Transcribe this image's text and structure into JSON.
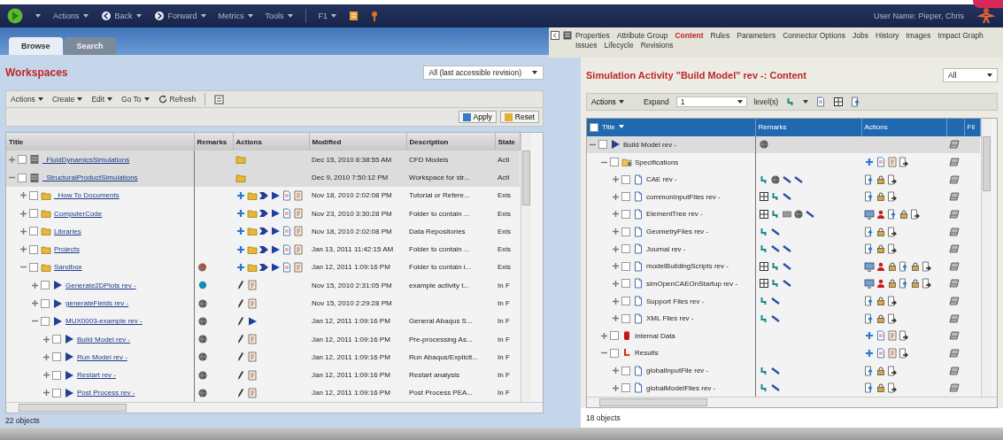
{
  "top_bar": {
    "menus": [
      {
        "label": "Actions"
      },
      {
        "label": "Back",
        "kind": "back"
      },
      {
        "label": "Forward",
        "kind": "forward"
      },
      {
        "label": "Metrics"
      },
      {
        "label": "Tools"
      },
      {
        "label": "F1"
      }
    ],
    "user": "User Name: Pieper, Chris"
  },
  "left": {
    "tabs": [
      {
        "label": "Browse",
        "selected": true
      },
      {
        "label": "Search",
        "selected": false
      }
    ],
    "heading": "Workspaces",
    "revision_filter": "All (last accessible revision)",
    "menus": [
      "Actions",
      "Create",
      "Edit",
      "Go To"
    ],
    "refresh": "Refresh",
    "apply": "Apply",
    "reset": "Reset",
    "table": {
      "columns": [
        "Title",
        "Remarks",
        "Actions",
        "Modified",
        "Description",
        "State"
      ],
      "rows": [
        {
          "title": "_FluidDynamicsSimulations",
          "kind": "workspace",
          "checked": false,
          "expanded": false,
          "selected": true,
          "actions": [
            {
              "kind": "folder"
            }
          ],
          "modified": "Dec 15, 2010 8:38:55 AM",
          "description": "CFD Models",
          "state": "Acti"
        },
        {
          "title": "_StructuralProductSimulations",
          "kind": "workspace",
          "checked": false,
          "expanded": true,
          "selected": true,
          "actions": [
            {
              "kind": "folder"
            }
          ],
          "modified": "Dec 9, 2010 7:50:12 PM",
          "description": "Workspace for str...",
          "state": "Acti",
          "children": [
            {
              "title": "_How To Documents",
              "kind": "folder",
              "checked": false,
              "expanded": false,
              "selected": false,
              "actions": [
                {
                  "kind": "add"
                },
                {
                  "kind": "folder"
                },
                {
                  "kind": "arrow"
                },
                {
                  "kind": "play"
                },
                {
                  "kind": "page"
                },
                {
                  "kind": "form"
                }
              ],
              "modified": "Nov 18, 2010 2:02:08 PM",
              "description": "Tutorial or Refere...",
              "state": "Exis"
            },
            {
              "title": "ComputerCode",
              "kind": "folder",
              "checked": false,
              "expanded": false,
              "selected": false,
              "actions": [
                {
                  "kind": "add"
                },
                {
                  "kind": "folder"
                },
                {
                  "kind": "arrow"
                },
                {
                  "kind": "play"
                },
                {
                  "kind": "page"
                },
                {
                  "kind": "form"
                }
              ],
              "modified": "Nov 23, 2010 3:30:28 PM",
              "description": "Folder to contain ...",
              "state": "Exis"
            },
            {
              "title": "Libraries",
              "kind": "folder",
              "checked": false,
              "expanded": false,
              "selected": false,
              "actions": [
                {
                  "kind": "add"
                },
                {
                  "kind": "folder"
                },
                {
                  "kind": "arrow"
                },
                {
                  "kind": "play"
                },
                {
                  "kind": "page"
                },
                {
                  "kind": "form"
                }
              ],
              "modified": "Nov 18, 2010 2:02:08 PM",
              "description": "Data Repositories",
              "state": "Exis"
            },
            {
              "title": "Projects",
              "kind": "folder",
              "checked": false,
              "expanded": false,
              "selected": false,
              "actions": [
                {
                  "kind": "add"
                },
                {
                  "kind": "folder"
                },
                {
                  "kind": "arrow"
                },
                {
                  "kind": "play"
                },
                {
                  "kind": "page"
                },
                {
                  "kind": "form"
                }
              ],
              "modified": "Jan 13, 2011 11:42:15 AM",
              "description": "Folder to contain ...",
              "state": "Exis"
            },
            {
              "title": "Sandbox",
              "kind": "folder",
              "checked": false,
              "expanded": true,
              "selected": false,
              "remarks": [
                {
                  "kind": "chart"
                }
              ],
              "actions": [
                {
                  "kind": "add"
                },
                {
                  "kind": "folder"
                },
                {
                  "kind": "arrow"
                },
                {
                  "kind": "play"
                },
                {
                  "kind": "page"
                },
                {
                  "kind": "form"
                }
              ],
              "modified": "Jan 12, 2011 1:09:16 PM",
              "description": "Folder to contain i...",
              "state": "Exis",
              "children": [
                {
                  "title": "Generate2DPlots rev -",
                  "kind": "activity",
                  "checked": false,
                  "expanded": false,
                  "selected": false,
                  "remarks": [
                    {
                      "kind": "dot"
                    }
                  ],
                  "actions": [
                    {
                      "kind": "pencil"
                    },
                    {
                      "kind": "form"
                    }
                  ],
                  "modified": "Nov 15, 2010 2:31:05 PM",
                  "description": "example activity t...",
                  "state": "In F"
                },
                {
                  "title": "generateFields rev -",
                  "kind": "activity",
                  "checked": false,
                  "expanded": false,
                  "selected": false,
                  "remarks": [
                    {
                      "kind": "globe"
                    }
                  ],
                  "actions": [
                    {
                      "kind": "pencil"
                    },
                    {
                      "kind": "form"
                    }
                  ],
                  "modified": "Nov 15, 2010 2:29:28 PM",
                  "state": "In F"
                },
                {
                  "title": "MUX0003-example rev -",
                  "kind": "activity",
                  "checked": false,
                  "expanded": true,
                  "selected": false,
                  "remarks": [
                    {
                      "kind": "globe"
                    }
                  ],
                  "actions": [
                    {
                      "kind": "pencil"
                    },
                    {
                      "kind": "play"
                    }
                  ],
                  "modified": "Jan 12, 2011 1:09:16 PM",
                  "description": "General Abaqus S...",
                  "state": "In F",
                  "children": [
                    {
                      "title": "Build Model rev -",
                      "kind": "activity",
                      "checked": false,
                      "expanded": false,
                      "selected": false,
                      "remarks": [
                        {
                          "kind": "globe"
                        }
                      ],
                      "actions": [
                        {
                          "kind": "pencil"
                        },
                        {
                          "kind": "form"
                        }
                      ],
                      "modified": "Jan 12, 2011 1:09:16 PM",
                      "description": "Pre-processing As...",
                      "state": "In F"
                    },
                    {
                      "title": "Run Model rev -",
                      "kind": "activity",
                      "checked": false,
                      "expanded": false,
                      "selected": false,
                      "remarks": [
                        {
                          "kind": "globe"
                        }
                      ],
                      "actions": [
                        {
                          "kind": "pencil"
                        },
                        {
                          "kind": "form"
                        }
                      ],
                      "modified": "Jan 12, 2011 1:09:16 PM",
                      "description": "Run Abaqus/Explicit...",
                      "state": "In F"
                    },
                    {
                      "title": "Restart rev -",
                      "kind": "activity",
                      "checked": false,
                      "expanded": false,
                      "selected": false,
                      "remarks": [
                        {
                          "kind": "globe"
                        }
                      ],
                      "actions": [
                        {
                          "kind": "pencil"
                        },
                        {
                          "kind": "form"
                        }
                      ],
                      "modified": "Jan 12, 2011 1:09:16 PM",
                      "description": "Restart analysis",
                      "state": "In F"
                    },
                    {
                      "title": "Post Process rev -",
                      "kind": "activity",
                      "checked": false,
                      "expanded": false,
                      "selected": false,
                      "remarks": [
                        {
                          "kind": "globe"
                        }
                      ],
                      "actions": [
                        {
                          "kind": "pencil"
                        },
                        {
                          "kind": "form"
                        }
                      ],
                      "modified": "Jan 12, 2011 1:09:16 PM",
                      "description": "Post Process PEA...",
                      "state": "In F"
                    }
                  ]
                }
              ]
            }
          ]
        }
      ]
    },
    "status": "22 objects"
  },
  "right": {
    "tabs": [
      {
        "label": "Properties",
        "selected": false
      },
      {
        "label": "Attribute Group",
        "selected": false
      },
      {
        "label": "Content",
        "selected": true
      },
      {
        "label": "Rules",
        "selected": false
      },
      {
        "label": "Parameters",
        "selected": false
      },
      {
        "label": "Connector Options",
        "selected": false
      },
      {
        "label": "Jobs",
        "selected": false
      },
      {
        "label": "History",
        "selected": false
      },
      {
        "label": "Images",
        "selected": false
      },
      {
        "label": "Impact Graph",
        "selected": false
      },
      {
        "label": "Issues",
        "selected": false
      },
      {
        "label": "Lifecycle",
        "selected": false
      },
      {
        "label": "Revisions",
        "selected": false
      }
    ],
    "heading": "Simulation Activity \"Build Model\" rev -: Content",
    "filter": "All",
    "menu": "Actions",
    "expand_label": "Expand",
    "expand_value": "1",
    "levels_label": "level(s)",
    "table": {
      "columns": [
        "Title",
        "Remarks",
        "Actions"
      ],
      "column_5": "Fil",
      "rows": [
        {
          "title": "Build Model rev -",
          "kind": "activity",
          "checked": false,
          "expanded": true,
          "selected": true,
          "remarks": [
            {
              "kind": "globe"
            }
          ],
          "children": [
            {
              "title": "Specifications",
              "kind": "specs",
              "checked": false,
              "expanded": true,
              "selected": false,
              "actions": [
                {
                  "kind": "add"
                },
                {
                  "kind": "page"
                },
                {
                  "kind": "form"
                },
                {
                  "kind": "export"
                }
              ],
              "children": [
                {
                  "title": "CAE rev -",
                  "kind": "document",
                  "checked": false,
                  "expanded": false,
                  "selected": false,
                  "remarks": [
                    {
                      "kind": "hook"
                    },
                    {
                      "kind": "globe"
                    },
                    {
                      "kind": "link"
                    },
                    {
                      "kind": "link"
                    }
                  ],
                  "actions": [
                    {
                      "kind": "upload"
                    },
                    {
                      "kind": "lock"
                    },
                    {
                      "kind": "export"
                    }
                  ]
                },
                {
                  "title": "commonInputFiles rev -",
                  "kind": "document",
                  "checked": false,
                  "expanded": false,
                  "selected": false,
                  "remarks": [
                    {
                      "kind": "grid"
                    },
                    {
                      "kind": "hook"
                    },
                    {
                      "kind": "link"
                    }
                  ],
                  "actions": [
                    {
                      "kind": "upload"
                    },
                    {
                      "kind": "lock"
                    },
                    {
                      "kind": "export"
                    }
                  ]
                },
                {
                  "title": "ElementTree rev -",
                  "kind": "document",
                  "checked": false,
                  "expanded": false,
                  "selected": false,
                  "remarks": [
                    {
                      "kind": "grid"
                    },
                    {
                      "kind": "hook"
                    },
                    {
                      "kind": "bar"
                    },
                    {
                      "kind": "globe"
                    },
                    {
                      "kind": "link"
                    }
                  ],
                  "actions": [
                    {
                      "kind": "monitor"
                    },
                    {
                      "kind": "person"
                    },
                    {
                      "kind": "upload"
                    },
                    {
                      "kind": "lock"
                    },
                    {
                      "kind": "export"
                    }
                  ]
                },
                {
                  "title": "GeometryFiles rev -",
                  "kind": "document",
                  "checked": false,
                  "expanded": false,
                  "selected": false,
                  "remarks": [
                    {
                      "kind": "hook"
                    },
                    {
                      "kind": "link"
                    }
                  ],
                  "actions": [
                    {
                      "kind": "upload"
                    },
                    {
                      "kind": "lock"
                    },
                    {
                      "kind": "export"
                    }
                  ]
                },
                {
                  "title": "Journal rev -",
                  "kind": "document",
                  "checked": false,
                  "expanded": false,
                  "selected": false,
                  "remarks": [
                    {
                      "kind": "hook"
                    },
                    {
                      "kind": "link"
                    },
                    {
                      "kind": "link"
                    }
                  ],
                  "actions": [
                    {
                      "kind": "upload"
                    },
                    {
                      "kind": "lock"
                    },
                    {
                      "kind": "export"
                    }
                  ]
                },
                {
                  "title": "modelBuildingScripts rev -",
                  "kind": "document",
                  "checked": false,
                  "expanded": false,
                  "selected": false,
                  "remarks": [
                    {
                      "kind": "grid"
                    },
                    {
                      "kind": "hook"
                    },
                    {
                      "kind": "link"
                    }
                  ],
                  "actions": [
                    {
                      "kind": "monitor"
                    },
                    {
                      "kind": "person"
                    },
                    {
                      "kind": "lock"
                    },
                    {
                      "kind": "upload"
                    },
                    {
                      "kind": "lock"
                    },
                    {
                      "kind": "export"
                    }
                  ]
                },
                {
                  "title": "simOpenCAEOnStartup rev -",
                  "kind": "document",
                  "checked": false,
                  "expanded": false,
                  "selected": false,
                  "remarks": [
                    {
                      "kind": "grid"
                    },
                    {
                      "kind": "hook"
                    },
                    {
                      "kind": "link"
                    }
                  ],
                  "actions": [
                    {
                      "kind": "monitor"
                    },
                    {
                      "kind": "person"
                    },
                    {
                      "kind": "lock"
                    },
                    {
                      "kind": "upload"
                    },
                    {
                      "kind": "lock"
                    },
                    {
                      "kind": "export"
                    }
                  ]
                },
                {
                  "title": "Support Files rev -",
                  "kind": "document",
                  "checked": false,
                  "expanded": false,
                  "selected": false,
                  "remarks": [
                    {
                      "kind": "hook"
                    },
                    {
                      "kind": "link"
                    }
                  ],
                  "actions": [
                    {
                      "kind": "upload"
                    },
                    {
                      "kind": "lock"
                    },
                    {
                      "kind": "export"
                    }
                  ]
                },
                {
                  "title": "XML Files rev -",
                  "kind": "document",
                  "checked": false,
                  "expanded": false,
                  "selected": false,
                  "remarks": [
                    {
                      "kind": "hook"
                    },
                    {
                      "kind": "link"
                    }
                  ],
                  "actions": [
                    {
                      "kind": "upload"
                    },
                    {
                      "kind": "lock"
                    },
                    {
                      "kind": "export"
                    }
                  ]
                }
              ]
            },
            {
              "title": "Internal Data",
              "kind": "internal",
              "checked": false,
              "expanded": false,
              "selected": false,
              "actions": [
                {
                  "kind": "add"
                },
                {
                  "kind": "page"
                },
                {
                  "kind": "form"
                },
                {
                  "kind": "export"
                }
              ]
            },
            {
              "title": "Results",
              "kind": "results",
              "checked": false,
              "expanded": true,
              "selected": false,
              "actions": [
                {
                  "kind": "add"
                },
                {
                  "kind": "page"
                },
                {
                  "kind": "form"
                },
                {
                  "kind": "export"
                }
              ],
              "children": [
                {
                  "title": "globalInputFile rev -",
                  "kind": "document",
                  "checked": false,
                  "expanded": false,
                  "selected": false,
                  "remarks": [
                    {
                      "kind": "hook"
                    },
                    {
                      "kind": "link"
                    }
                  ],
                  "actions": [
                    {
                      "kind": "upload"
                    },
                    {
                      "kind": "lock"
                    },
                    {
                      "kind": "export"
                    }
                  ]
                },
                {
                  "title": "globalModelFiles rev -",
                  "kind": "document",
                  "checked": false,
                  "expanded": false,
                  "selected": false,
                  "remarks": [
                    {
                      "kind": "hook"
                    },
                    {
                      "kind": "link"
                    }
                  ],
                  "actions": [
                    {
                      "kind": "upload"
                    },
                    {
                      "kind": "lock"
                    },
                    {
                      "kind": "export"
                    }
                  ]
                }
              ]
            }
          ]
        }
      ]
    },
    "status": "18 objects"
  }
}
